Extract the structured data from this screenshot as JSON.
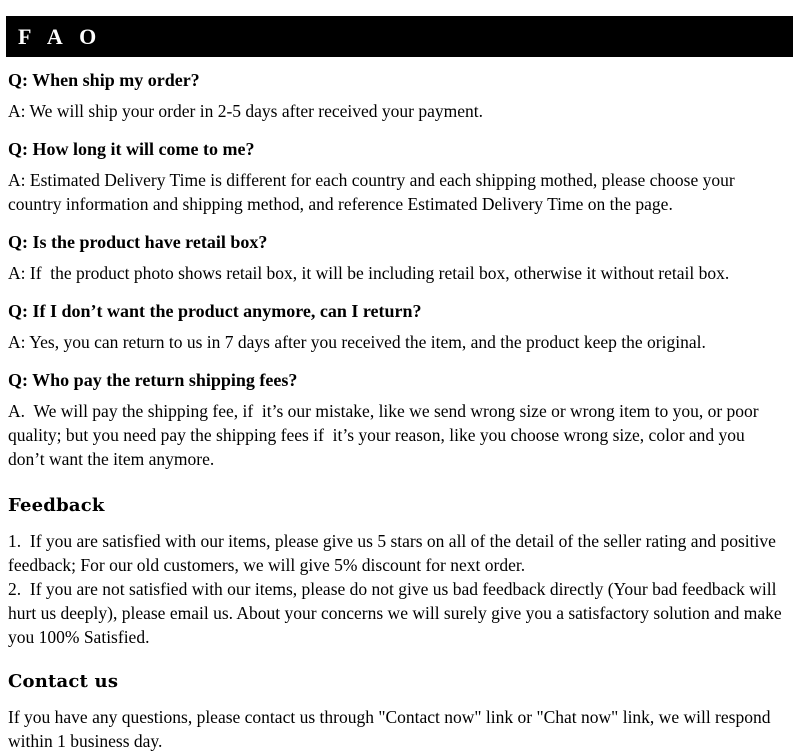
{
  "header": {
    "title": "F A O",
    "background_color": "#000000",
    "text_color": "#ffffff"
  },
  "faq": {
    "items": [
      {
        "question": "Q: When ship my order?",
        "answer": "A: We will ship your order in 2-5 days after received your payment."
      },
      {
        "question": "Q: How long it will come to me?",
        "answer": "A: Estimated Delivery Time is different for each country and each shipping mothed, please choose your country information and shipping method, and reference Estimated Delivery Time on the page."
      },
      {
        "question": "Q: Is the product have retail box?",
        "answer": "A: If  the product photo shows retail box, it will be including retail box, otherwise it without retail box."
      },
      {
        "question": "Q: If I don’t want the product anymore, can I return?",
        "answer": "A: Yes, you can return to us in 7 days after you received the item, and the product keep the original."
      },
      {
        "question": "Q: Who pay the return shipping fees?",
        "answer": "A.  We will pay the shipping fee, if  it’s our mistake, like we send wrong size or wrong item to you, or poor quality; but you need pay the shipping fees if  it’s your reason, like you choose wrong size, color and you don’t want the item anymore."
      }
    ]
  },
  "feedback": {
    "heading": "Feedback",
    "item_1": "1.  If you are satisfied with our items, please give us 5 stars on all of the detail of the seller rating and positive feedback; For our old customers, we will give 5% discount for next order.",
    "item_2": "2.  If you are not satisfied with our items, please do not give us bad feedback directly (Your bad feedback will hurt us deeply), please email us. About your concerns we will surely give you a satisfactory solution and make you 100% Satisfied."
  },
  "contact": {
    "heading": "Contact us",
    "body": "If you have any questions, please contact us through \"Contact now\" link or \"Chat now\" link, we will respond within 1 business day."
  }
}
